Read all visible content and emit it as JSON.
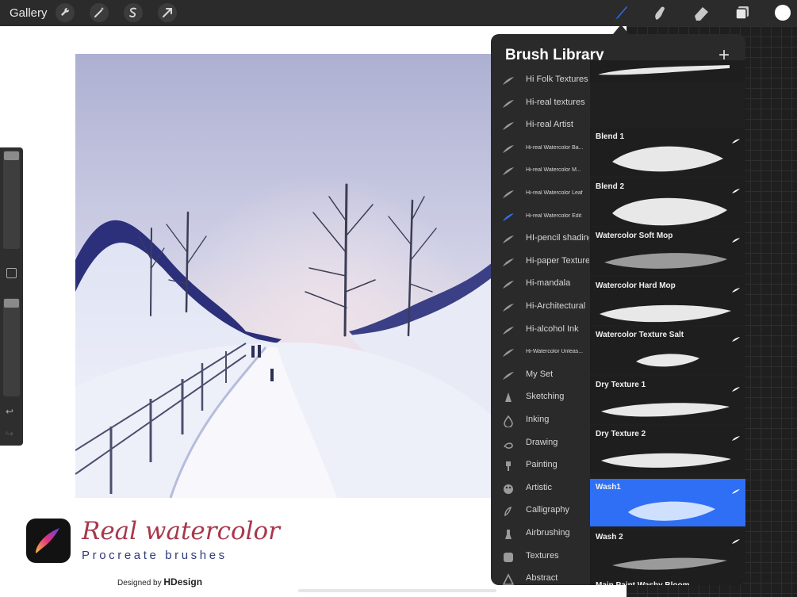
{
  "app": {
    "title": "Procreate"
  },
  "toolbar": {
    "gallery_label": "Gallery",
    "left_tools": [
      {
        "icon": "wrench-icon",
        "glyph": "🔧"
      },
      {
        "icon": "magic-wand-icon",
        "glyph": "✧"
      },
      {
        "icon": "selection-icon",
        "glyph": "S"
      },
      {
        "icon": "transform-arrow-icon",
        "glyph": "➚"
      }
    ],
    "right_tools": [
      "brush-icon",
      "smudge-icon",
      "eraser-icon",
      "layers-icon",
      "color-icon"
    ],
    "active_tool": "brush-icon",
    "active_color": "#2f6ff5",
    "current_color": "#ffffff"
  },
  "sidebar": {
    "undo_glyph": "↩",
    "redo_glyph": "↪"
  },
  "brand": {
    "title": "Real watercolor",
    "subtitle": "Procreate brushes",
    "designed_by": "Designed by ",
    "designer": "HDesign"
  },
  "brush_library": {
    "title": "Brush Library",
    "add_glyph": "+",
    "sets": [
      {
        "label": "Hi Folk Textures",
        "icon": "feather-icon",
        "selected": false,
        "small": false
      },
      {
        "label": "Hi-real textures",
        "icon": "feather-icon",
        "selected": false,
        "small": false
      },
      {
        "label": "Hi-real Artist",
        "icon": "feather-icon",
        "selected": false,
        "small": false
      },
      {
        "label": "Hi-real Watercolor Ba...",
        "icon": "feather-icon",
        "selected": false,
        "small": true
      },
      {
        "label": "Hi-real Watercolor M...",
        "icon": "feather-icon",
        "selected": false,
        "small": true
      },
      {
        "label": "Hi-real Watercolor Leaf",
        "icon": "feather-icon",
        "selected": false,
        "small": true
      },
      {
        "label": "Hi-real Watercolor Edit",
        "icon": "feather-icon",
        "selected": true,
        "small": true
      },
      {
        "label": "HI-pencil shading",
        "icon": "feather-icon",
        "selected": false,
        "small": false
      },
      {
        "label": "Hi-paper Texture",
        "icon": "feather-icon",
        "selected": false,
        "small": false
      },
      {
        "label": "Hi-mandala",
        "icon": "feather-icon",
        "selected": false,
        "small": false
      },
      {
        "label": "Hi-Architectural",
        "icon": "feather-icon",
        "selected": false,
        "small": false
      },
      {
        "label": "Hi-alcohol Ink",
        "icon": "feather-icon",
        "selected": false,
        "small": false
      },
      {
        "label": "Hi-Watercolor Unleas...",
        "icon": "feather-icon",
        "selected": false,
        "small": true
      },
      {
        "label": "My Set",
        "icon": "feather-icon",
        "selected": false,
        "small": false
      },
      {
        "label": "Sketching",
        "icon": "pencil-tip-icon",
        "selected": false,
        "small": false
      },
      {
        "label": "Inking",
        "icon": "ink-drop-icon",
        "selected": false,
        "small": false
      },
      {
        "label": "Drawing",
        "icon": "squiggle-icon",
        "selected": false,
        "small": false
      },
      {
        "label": "Painting",
        "icon": "paintbrush-icon",
        "selected": false,
        "small": false
      },
      {
        "label": "Artistic",
        "icon": "palette-icon",
        "selected": false,
        "small": false
      },
      {
        "label": "Calligraphy",
        "icon": "calligraphy-icon",
        "selected": false,
        "small": false
      },
      {
        "label": "Airbrushing",
        "icon": "airbrush-icon",
        "selected": false,
        "small": false
      },
      {
        "label": "Textures",
        "icon": "texture-icon",
        "selected": false,
        "small": false
      },
      {
        "label": "Abstract",
        "icon": "triangle-icon",
        "selected": false,
        "small": false
      }
    ],
    "brushes": [
      {
        "name": "",
        "selected": false
      },
      {
        "name": "Blend 1",
        "selected": false
      },
      {
        "name": "Blend 2",
        "selected": false
      },
      {
        "name": "Watercolor Soft Mop",
        "selected": false
      },
      {
        "name": "Watercolor Hard Mop",
        "selected": false
      },
      {
        "name": "Watercolor Texture Salt",
        "selected": false
      },
      {
        "name": "Dry Texture 1",
        "selected": false
      },
      {
        "name": "Dry Texture 2",
        "selected": false
      },
      {
        "name": "Wash1",
        "selected": true
      },
      {
        "name": "Wash 2",
        "selected": false
      },
      {
        "name": "Main Paint Washy Bloom",
        "selected": false
      }
    ]
  }
}
